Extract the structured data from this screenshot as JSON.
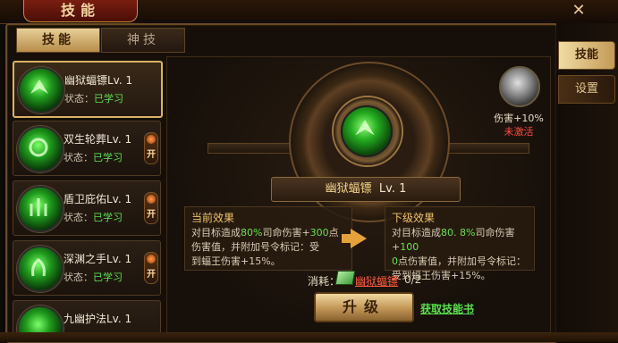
{
  "title": "技能",
  "tabs": [
    {
      "label": "技能",
      "active": true
    },
    {
      "label": "神技",
      "active": false
    }
  ],
  "side_tabs": [
    {
      "label": "技能",
      "active": true
    },
    {
      "label": "设置",
      "active": false
    }
  ],
  "skills": [
    {
      "name": "幽狱蝠镖Lv. 1",
      "status_label": "状态：",
      "status_value": "已学习",
      "toggle": null
    },
    {
      "name": "双生轮葬Lv. 1",
      "status_label": "状态：",
      "status_value": "已学习",
      "toggle": "开"
    },
    {
      "name": "盾卫庇佑Lv. 1",
      "status_label": "状态：",
      "status_value": "已学习",
      "toggle": "开"
    },
    {
      "name": "深渊之手Lv. 1",
      "status_label": "状态：",
      "status_value": "已学习",
      "toggle": "开"
    },
    {
      "name": "九幽护法Lv. 1",
      "status_label": "",
      "status_value": "",
      "toggle": null
    }
  ],
  "detail": {
    "skill_name": "幽狱蝠镖",
    "skill_level": "Lv. 1",
    "passive": {
      "damage": "伤害+10%",
      "state": "未激活"
    },
    "current": {
      "title": "当前效果",
      "line1_a": "对目标造成",
      "line1_pct": "80%",
      "line1_b": "司命伤害+",
      "line1_val": "300",
      "line1_c": "点",
      "line2": "伤害值，并附加号令标记：受",
      "line3": "到蝠王伤害+15%。"
    },
    "next": {
      "title": "下级效果",
      "line1_a": "对目标造成",
      "line1_pct": "80. 8%",
      "line1_b": "司命伤害+",
      "line1_val": "100",
      "line2_val": "0",
      "line2": "点伤害值，并附加号令标记：",
      "line3": "受到蝠王伤害+15%。"
    },
    "cost_label": "消耗：",
    "cost_item": "幽狱蝠镖",
    "cost_count": "0/2",
    "upgrade_label": "升级",
    "get_book_label": "获取技能书"
  },
  "colors": {
    "accent_gold": "#d9b264",
    "highlight_green": "#68e049",
    "warning_red": "#ff4b3a"
  }
}
